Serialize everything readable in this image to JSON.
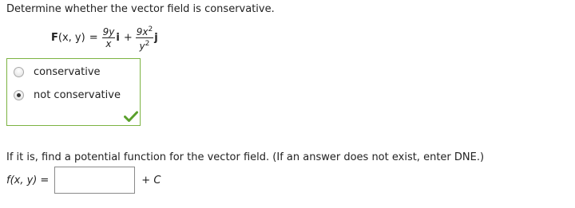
{
  "question": {
    "text": "Determine whether the vector field is conservative."
  },
  "formula": {
    "lhs_bold": "F",
    "lhs_args": "(x, y)",
    "equals": "=",
    "term1": {
      "numerator": "9y",
      "denominator": "x",
      "unit": "i"
    },
    "plus": "+",
    "term2": {
      "numerator_base": "9x",
      "numerator_exp": "2",
      "denominator_base": "y",
      "denominator_exp": "2",
      "unit": "j"
    }
  },
  "options": {
    "items": [
      {
        "label": "conservative",
        "selected": false
      },
      {
        "label": "not conservative",
        "selected": true
      }
    ],
    "status": "correct",
    "border_color": "#7cb342",
    "check_color": "#5aa02c"
  },
  "followup": {
    "text": "If it is, find a potential function for the vector field. (If an answer does not exist, enter DNE.)"
  },
  "answer": {
    "label_fn": "f(x, y)",
    "label_eq": "=",
    "value": "",
    "suffix_plus": "+",
    "suffix_c": "C"
  }
}
